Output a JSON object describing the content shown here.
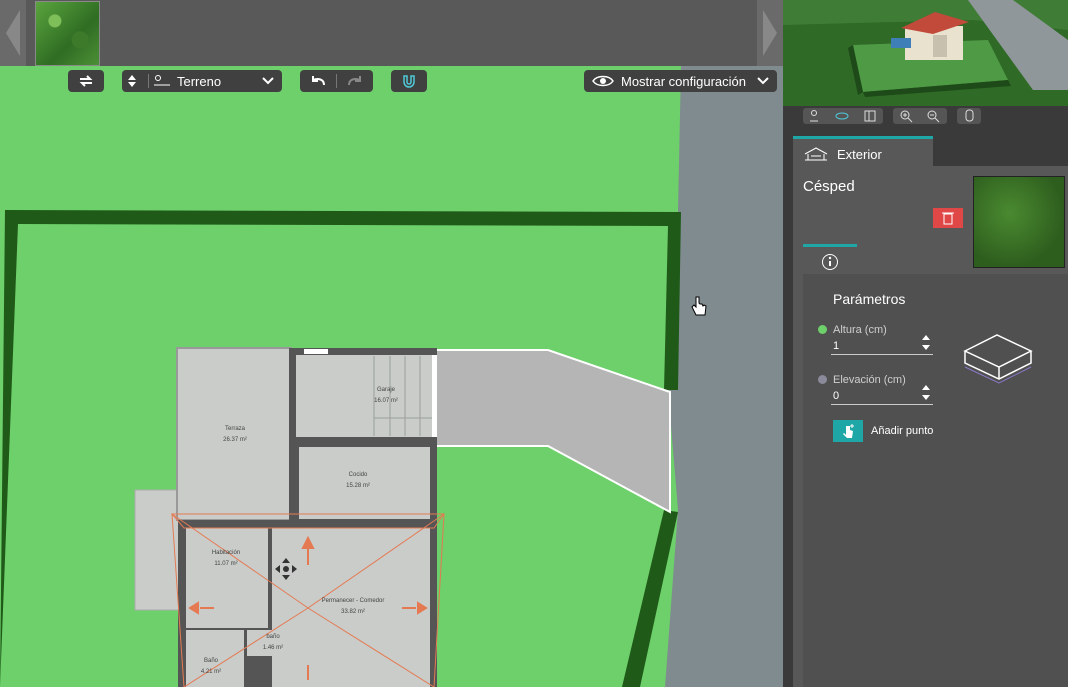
{
  "toolbar": {
    "level_label": "Terreno",
    "display_label": "Mostrar configuración"
  },
  "plan": {
    "rooms": [
      {
        "name": "Terraza",
        "area": "26.37 m²"
      },
      {
        "name": "Garaje",
        "area": "16.07 m²"
      },
      {
        "name": "Cocido",
        "area": "15.28 m²"
      },
      {
        "name": "Habitación",
        "area": "11.07 m²"
      },
      {
        "name": "Permanecer - Comedor",
        "area": "33.82 m²"
      },
      {
        "name": "baño",
        "area": "1.46 m²"
      },
      {
        "name": "Baño",
        "area": "4.21 m²"
      }
    ]
  },
  "panel": {
    "tab_label": "Exterior",
    "object_name": "Césped",
    "section_title": "Parámetros",
    "altura_label": "Altura (cm)",
    "altura_value": "1",
    "elevacion_label": "Elevación (cm)",
    "elevacion_value": "0",
    "add_point_label": "Añadir punto"
  },
  "colors": {
    "accent": "#1fa6a6",
    "delete": "#e04848",
    "lawn": "#6dd06a",
    "hedge": "#1f5a19",
    "road": "#7f8b8f"
  }
}
